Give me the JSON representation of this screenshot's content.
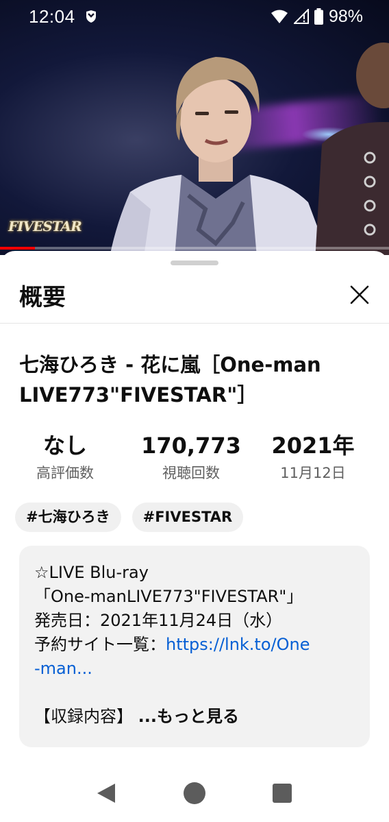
{
  "status_bar": {
    "time": "12:04",
    "battery": "98%",
    "icons": [
      "notification-shield-icon",
      "wifi-icon",
      "signal-icon",
      "battery-icon"
    ]
  },
  "video": {
    "logo_text": "FIVESTAR",
    "progress_fraction": 0.09,
    "progress_color": "#ff0000"
  },
  "sheet": {
    "title": "概要",
    "close_icon": "close-icon"
  },
  "video_info": {
    "title_line1": "七海ひろき - 花に嵐［One-man",
    "title_line2": "LIVE773\"FIVESTAR\"］",
    "stats": [
      {
        "value": "なし",
        "label": "高評価数"
      },
      {
        "value": "170,773",
        "label": "視聴回数"
      },
      {
        "value": "2021年",
        "label": "11月12日"
      }
    ],
    "tags": [
      "#七海ひろき",
      "#FIVESTAR"
    ]
  },
  "description": {
    "line1": "☆LIVE Blu-ray",
    "line2": "「One-manLIVE773\"FIVESTAR\"」",
    "line3": "発売日：2021年11月24日（水）",
    "line4_prefix": "予約サイト一覧：",
    "line4_link": "https://lnk.to/One",
    "line5_link": "-man...",
    "line6": "【収録内容】",
    "more": "...もっと見る"
  },
  "nav_bar": {
    "icons": [
      "back-icon",
      "home-icon",
      "recents-icon"
    ]
  }
}
